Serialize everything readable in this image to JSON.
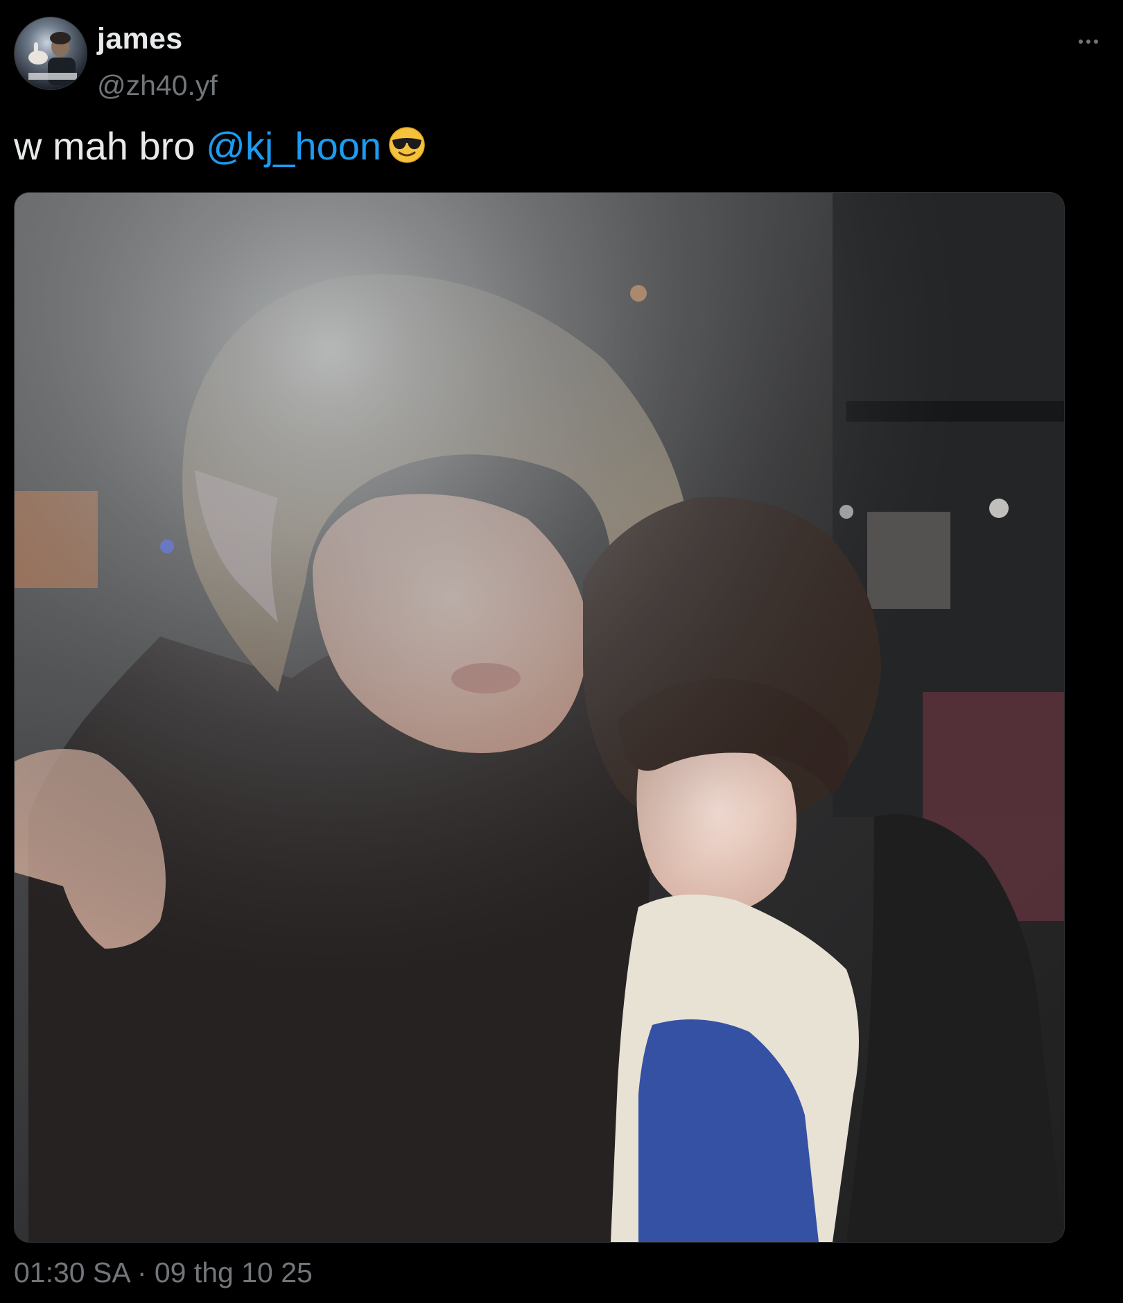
{
  "post": {
    "author": {
      "display_name": "james",
      "handle": "@zh40.yf",
      "avatar_icon": "profile-photo"
    },
    "text": {
      "prefix": "w mah bro ",
      "mention": "@kj_hoon",
      "emoji": "smiling-face-with-sunglasses"
    },
    "more_icon": "more-horizontal-icon",
    "media": {
      "type": "photo"
    },
    "timestamp": "01:30 SA · 09 thg 10 25"
  },
  "colors": {
    "background": "#000000",
    "primary_text": "#e7e9ea",
    "secondary_text": "#71767b",
    "link": "#1d9bf0"
  }
}
